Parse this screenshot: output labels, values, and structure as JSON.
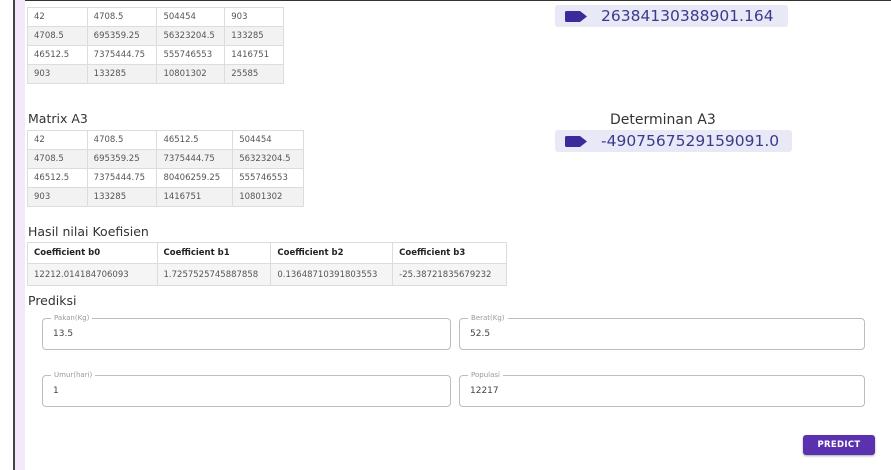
{
  "matrix_a2": {
    "rows": [
      [
        "42",
        "4708.5",
        "504454",
        "903"
      ],
      [
        "4708.5",
        "695359.25",
        "56323204.5",
        "133285"
      ],
      [
        "46512.5",
        "7375444.75",
        "555746553",
        "1416751"
      ],
      [
        "903",
        "133285",
        "10801302",
        "25585"
      ]
    ]
  },
  "determinant_a2": {
    "value": "26384130388901.164",
    "icon": "tag-icon"
  },
  "matrix_a3": {
    "title": "Matrix A3",
    "rows": [
      [
        "42",
        "4708.5",
        "46512.5",
        "504454"
      ],
      [
        "4708.5",
        "695359.25",
        "7375444.75",
        "56323204.5"
      ],
      [
        "46512.5",
        "7375444.75",
        "80406259.25",
        "555746553"
      ],
      [
        "903",
        "133285",
        "1416751",
        "10801302"
      ]
    ]
  },
  "determinant_a3": {
    "title": "Determinan A3",
    "value": "-4907567529159091.0",
    "icon": "tag-icon"
  },
  "coefficients": {
    "title": "Hasil nilai Koefisien",
    "headers": [
      "Coefficient b0",
      "Coefficient b1",
      "Coefficient b2",
      "Coefficient b3"
    ],
    "values": [
      "12212.014184706093",
      "1.7257525745887858",
      "0.13648710391803553",
      "-25.38721835679232"
    ]
  },
  "prediksi": {
    "title": "Prediksi",
    "fields": {
      "pakan": {
        "label": "Pakan(Kg)",
        "value": "13.5"
      },
      "berat": {
        "label": "Berat(Kg)",
        "value": "52.5"
      },
      "umur": {
        "label": "Umur(hari)",
        "value": "1"
      },
      "populasi": {
        "label": "Populasi",
        "value": "12217"
      }
    },
    "predict_label": "PREDICT"
  },
  "colors": {
    "accent": "#5a32b0",
    "chip_background": "#e9e8f6",
    "chip_text": "#3b3b8e",
    "icon": "#3a2a9a"
  }
}
